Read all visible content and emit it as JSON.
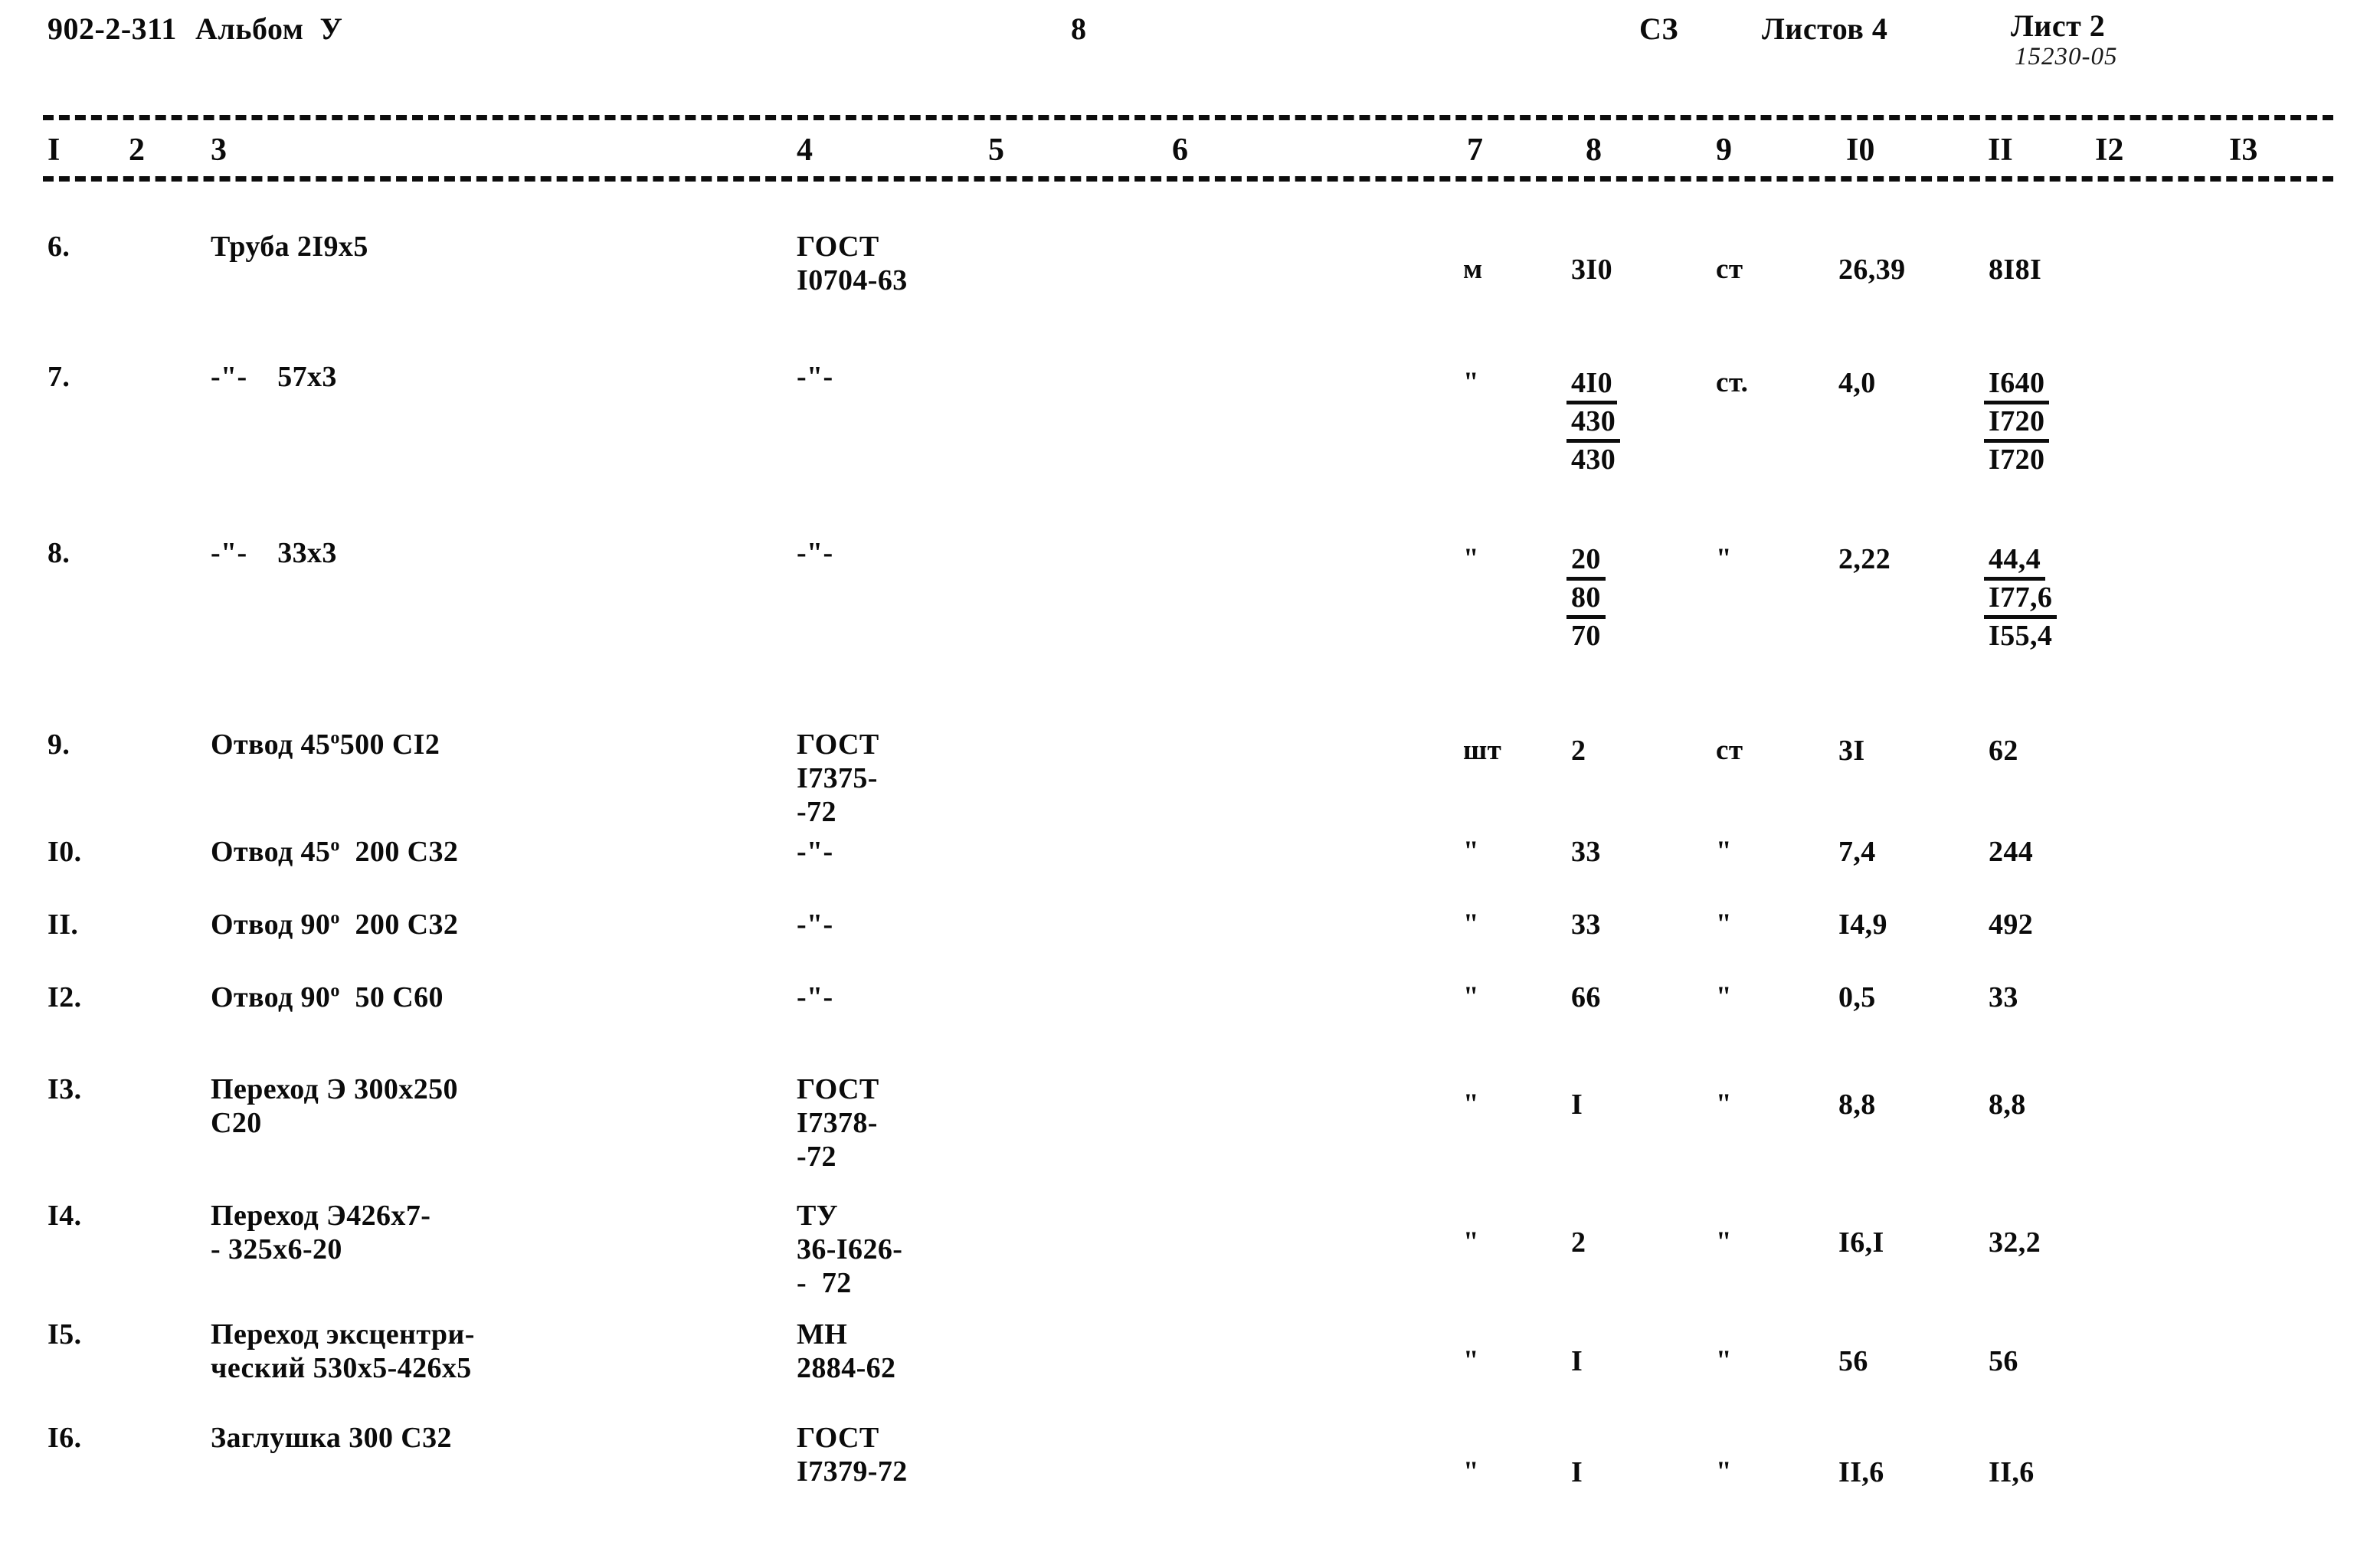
{
  "header": {
    "doc_code": "902-2-311",
    "album": "Альбом  У",
    "page_number": "8",
    "section_code": "СЗ",
    "sheets_total": "Листов 4",
    "sheet_current": "Лист 2",
    "archive_stamp": "15230-05"
  },
  "column_numbers": [
    "I",
    "2",
    "3",
    "4",
    "5",
    "6",
    "7",
    "8",
    "9",
    "I0",
    "II",
    "I2",
    "I3"
  ],
  "rows": [
    {
      "no": "6.",
      "name_l1": "Труба 2I9х5",
      "name_l2": "",
      "std_l1": "ГОСТ",
      "std_l2": "I0704-63",
      "std_l3": "",
      "unit": "м",
      "qty": [
        "3I0"
      ],
      "qty_underline": [
        false
      ],
      "material": "ст",
      "unit_mass": "26,39",
      "total_mass": [
        "8I8I"
      ],
      "total_underline": [
        false
      ]
    },
    {
      "no": "7.",
      "name_l1": "-\"-    57х3",
      "name_l2": "",
      "std_l1": "-\"-",
      "std_l2": "",
      "std_l3": "",
      "unit": "\"",
      "qty": [
        "4I0",
        "430",
        "430"
      ],
      "qty_underline": [
        true,
        true,
        false
      ],
      "material": "ст.",
      "unit_mass": "4,0",
      "total_mass": [
        "I640",
        "I720",
        "I720"
      ],
      "total_underline": [
        true,
        true,
        false
      ]
    },
    {
      "no": "8.",
      "name_l1": "-\"-    33х3",
      "name_l2": "",
      "std_l1": "-\"-",
      "std_l2": "",
      "std_l3": "",
      "unit": "\"",
      "qty": [
        "20",
        "80",
        "70"
      ],
      "qty_underline": [
        true,
        true,
        false
      ],
      "material": "\"",
      "unit_mass": "2,22",
      "total_mass": [
        "44,4",
        "I77,6",
        "I55,4"
      ],
      "total_underline": [
        true,
        true,
        false
      ]
    },
    {
      "no": "9.",
      "name_l1": "Отвод 45°500 СI2",
      "name_l2": "",
      "std_l1": "ГОСТ",
      "std_l2": "I7375-",
      "std_l3": "-72",
      "unit": "шт",
      "qty": [
        "2"
      ],
      "qty_underline": [
        false
      ],
      "material": "ст",
      "unit_mass": "3I",
      "total_mass": [
        "62"
      ],
      "total_underline": [
        false
      ]
    },
    {
      "no": "I0.",
      "name_l1": "Отвод 45°  200 С32",
      "name_l2": "",
      "std_l1": "-\"-",
      "std_l2": "",
      "std_l3": "",
      "unit": "\"",
      "qty": [
        "33"
      ],
      "qty_underline": [
        false
      ],
      "material": "\"",
      "unit_mass": "7,4",
      "total_mass": [
        "244"
      ],
      "total_underline": [
        false
      ]
    },
    {
      "no": "II.",
      "name_l1": "Отвод 90°  200 С32",
      "name_l2": "",
      "std_l1": "-\"-",
      "std_l2": "",
      "std_l3": "",
      "unit": "\"",
      "qty": [
        "33"
      ],
      "qty_underline": [
        false
      ],
      "material": "\"",
      "unit_mass": "I4,9",
      "total_mass": [
        "492"
      ],
      "total_underline": [
        false
      ]
    },
    {
      "no": "I2.",
      "name_l1": "Отвод 90°  50 С60",
      "name_l2": "",
      "std_l1": "-\"-",
      "std_l2": "",
      "std_l3": "",
      "unit": "\"",
      "qty": [
        "66"
      ],
      "qty_underline": [
        false
      ],
      "material": "\"",
      "unit_mass": "0,5",
      "total_mass": [
        "33"
      ],
      "total_underline": [
        false
      ]
    },
    {
      "no": "I3.",
      "name_l1": "Переход Э 300х250",
      "name_l2": "С20",
      "std_l1": "ГОСТ",
      "std_l2": "I7378-",
      "std_l3": "-72",
      "unit": "\"",
      "qty": [
        "I"
      ],
      "qty_underline": [
        false
      ],
      "material": "\"",
      "unit_mass": "8,8",
      "total_mass": [
        "8,8"
      ],
      "total_underline": [
        false
      ]
    },
    {
      "no": "I4.",
      "name_l1": "Переход Э426х7-",
      "name_l2": "- 325х6-20",
      "std_l1": "ТУ",
      "std_l2": "36-I626-",
      "std_l3": "-  72",
      "unit": "\"",
      "qty": [
        "2"
      ],
      "qty_underline": [
        false
      ],
      "material": "\"",
      "unit_mass": "I6,I",
      "total_mass": [
        "32,2"
      ],
      "total_underline": [
        false
      ]
    },
    {
      "no": "I5.",
      "name_l1": "Переход эксцентри-",
      "name_l2": "ческий 530х5-426х5",
      "std_l1": "МН",
      "std_l2": "2884-62",
      "std_l3": "",
      "unit": "\"",
      "qty": [
        "I"
      ],
      "qty_underline": [
        false
      ],
      "material": "\"",
      "unit_mass": "56",
      "total_mass": [
        "56"
      ],
      "total_underline": [
        false
      ]
    },
    {
      "no": "I6.",
      "name_l1": "Заглушка 300 С32",
      "name_l2": "",
      "std_l1": "ГОСТ",
      "std_l2": "I7379-72",
      "std_l3": "",
      "unit": "\"",
      "qty": [
        "I"
      ],
      "qty_underline": [
        false
      ],
      "material": "\"",
      "unit_mass": "II,6",
      "total_mass": [
        "II,6"
      ],
      "total_underline": [
        false
      ]
    }
  ]
}
